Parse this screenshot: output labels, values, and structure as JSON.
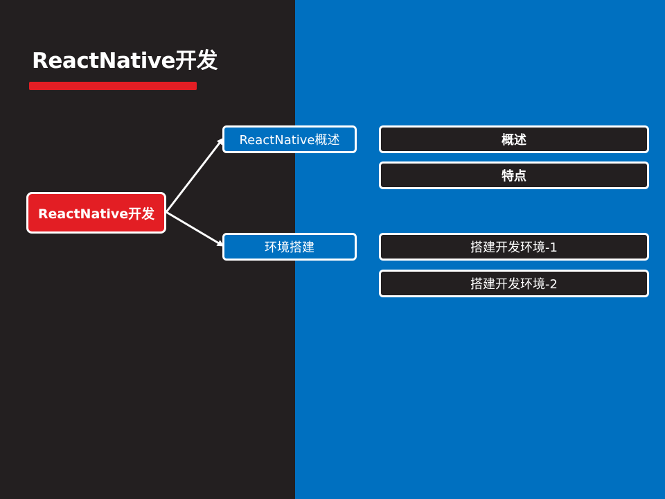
{
  "slide": {
    "title": "ReactNative开发"
  },
  "mindmap": {
    "root": {
      "label": "ReactNative开发"
    },
    "branches": [
      {
        "label": "ReactNative概述",
        "leaves": [
          {
            "label": "概述"
          },
          {
            "label": "特点"
          }
        ]
      },
      {
        "label": "环境搭建",
        "leaves": [
          {
            "label": "搭建开发环境-1"
          },
          {
            "label": "搭建开发环境-2"
          }
        ]
      }
    ]
  },
  "colors": {
    "left_background": "#231f20",
    "right_background": "#0070c0",
    "accent_red": "#e31e24",
    "border_white": "#ffffff"
  }
}
